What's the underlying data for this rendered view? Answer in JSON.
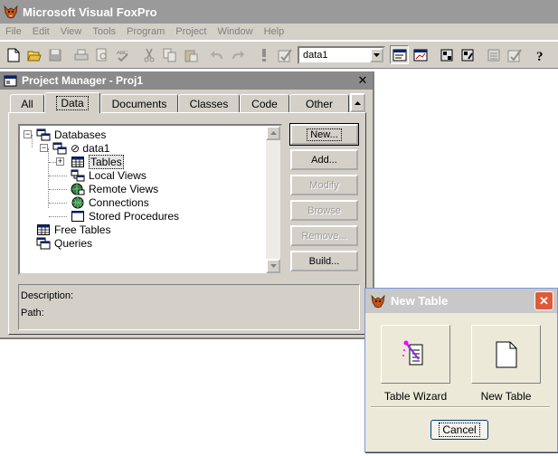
{
  "app": {
    "title": "Microsoft Visual FoxPro",
    "menu": [
      "File",
      "Edit",
      "View",
      "Tools",
      "Program",
      "Project",
      "Window",
      "Help"
    ],
    "toolbar": {
      "database_combo_value": "data1"
    }
  },
  "project_manager": {
    "title": "Project Manager - Proj1",
    "tabs": [
      "All",
      "Data",
      "Documents",
      "Classes",
      "Code",
      "Other"
    ],
    "active_tab": "Data",
    "tree": {
      "databases": "Databases",
      "data1": "⊘ data1",
      "tables": "Tables",
      "local_views": "Local Views",
      "remote_views": "Remote Views",
      "connections": "Connections",
      "stored_procedures": "Stored Procedures",
      "free_tables": "Free Tables",
      "queries": "Queries"
    },
    "buttons": {
      "new": "New...",
      "add": "Add...",
      "modify": "Modify",
      "browse": "Browse",
      "remove": "Remove...",
      "build": "Build..."
    },
    "description_label": "Description:",
    "path_label": "Path:"
  },
  "new_table_dialog": {
    "title": "New Table",
    "table_wizard": "Table Wizard",
    "new_table": "New Table",
    "cancel": "Cancel"
  },
  "colors": {
    "title_bar_inactive": "#9a9a9a",
    "face": "#d4d0c8",
    "xp_dialog": "#ece9d8",
    "xp_close": "#e05a3a"
  }
}
